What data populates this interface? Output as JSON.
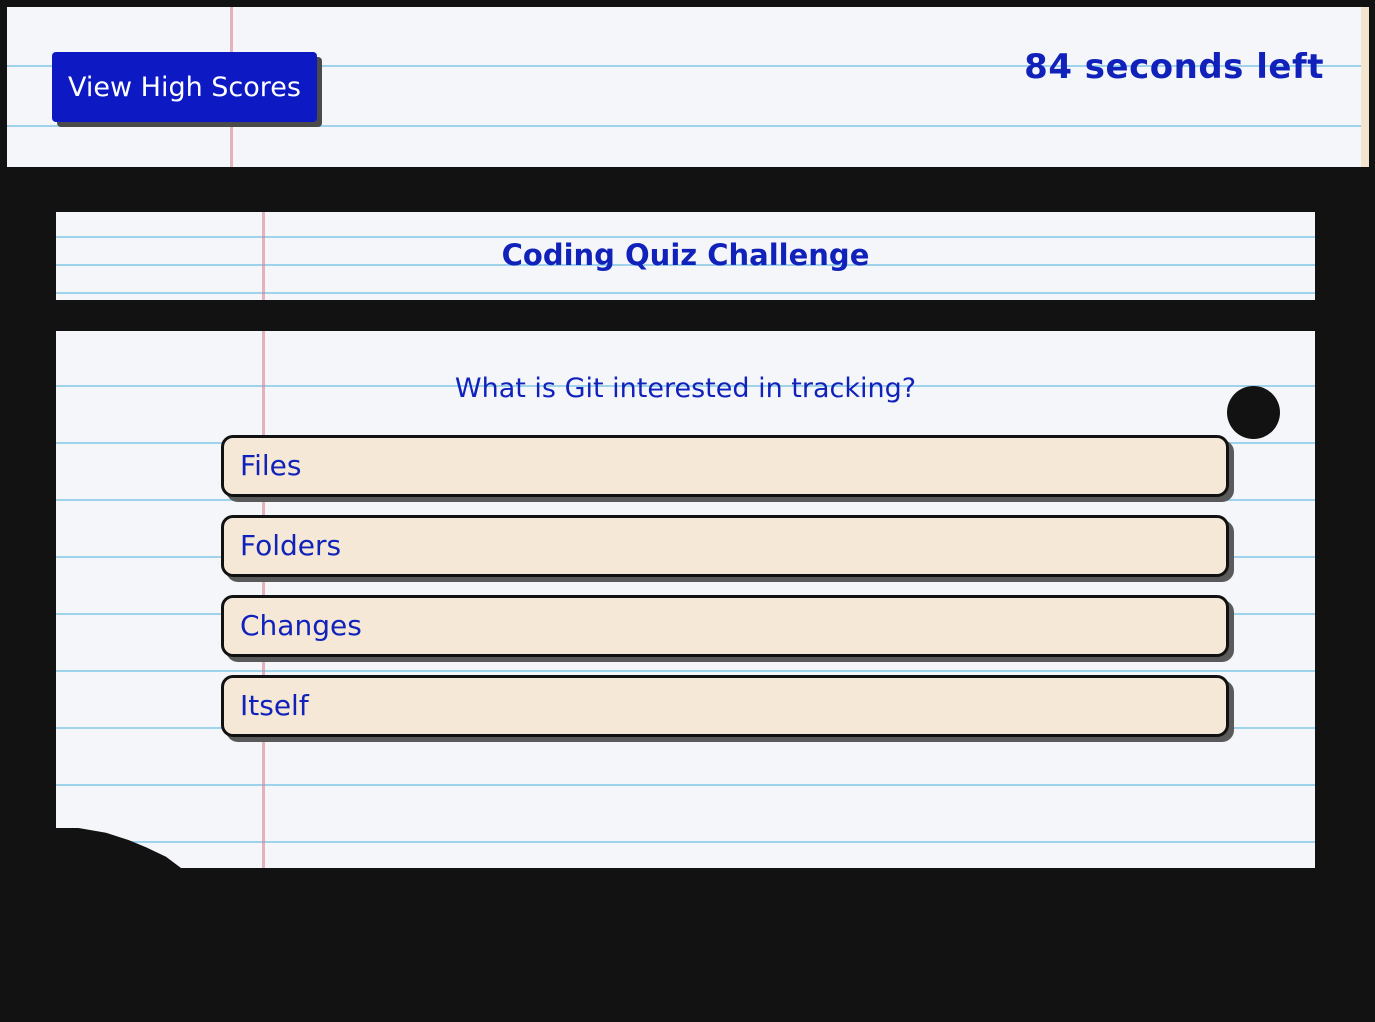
{
  "header": {
    "high_scores_label": "View High Scores",
    "timer_text": "84 seconds left"
  },
  "title_card": {
    "title": "Coding Quiz Challenge"
  },
  "quiz": {
    "question": "What is Git interested in tracking?",
    "answers": [
      {
        "label": "Files"
      },
      {
        "label": "Folders"
      },
      {
        "label": "Changes"
      },
      {
        "label": "Itself"
      }
    ]
  },
  "colors": {
    "background": "#121212",
    "accent_blue": "#0d1ac4",
    "text_blue": "#1122bb",
    "answer_fill": "#f5e8d6",
    "paper_line": "#9fd3ec",
    "paper_margin": "#d6788c"
  }
}
